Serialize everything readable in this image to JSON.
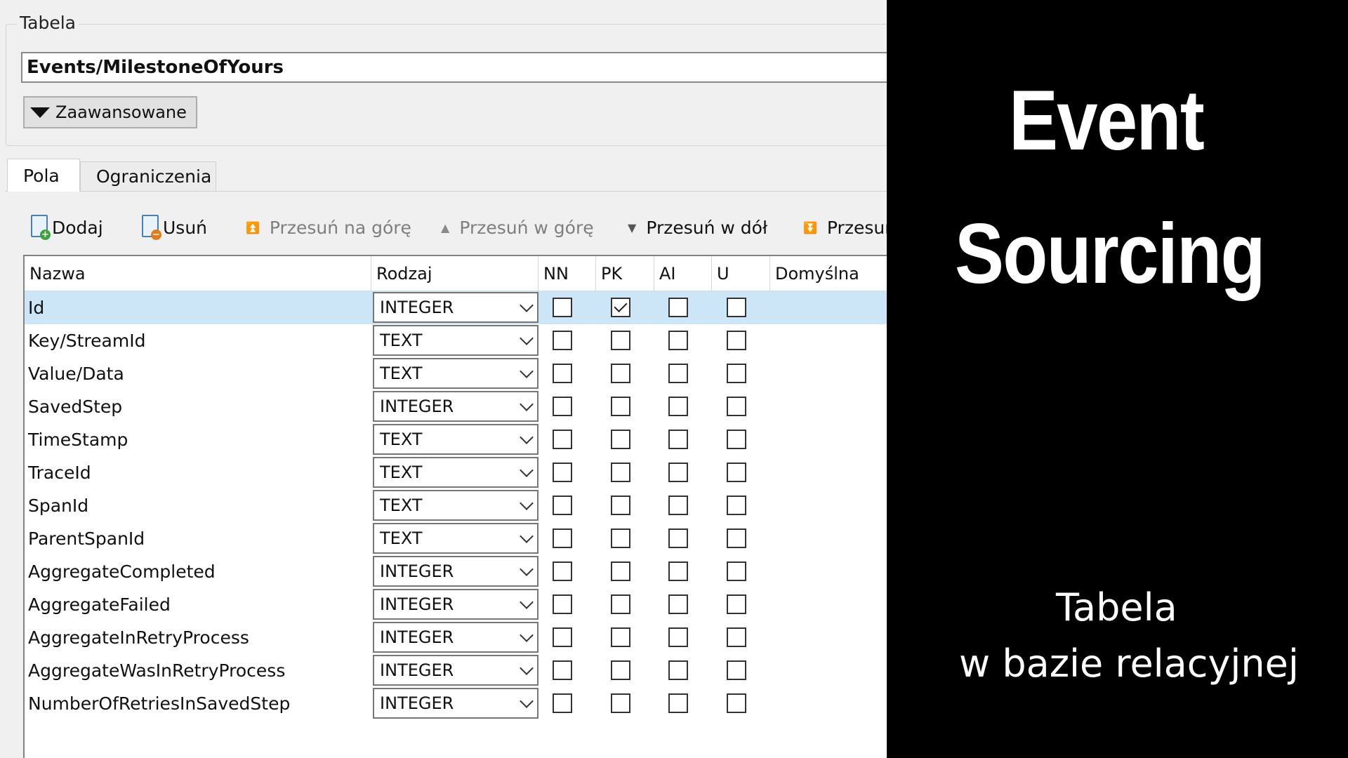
{
  "group": {
    "title": "Tabela",
    "table_name": "Events/MilestoneOfYours",
    "advanced_label": "Zaawansowane"
  },
  "tabs": [
    {
      "label": "Pola",
      "active": true
    },
    {
      "label": "Ograniczenia",
      "active": false
    }
  ],
  "toolbar": {
    "add": "Dodaj",
    "remove": "Usuń",
    "move_top": "Przesuń na górę",
    "move_up": "Przesuń w górę",
    "move_down": "Przesuń w dół",
    "move_bottom_partial": "Przesuń"
  },
  "columns": [
    "Nazwa",
    "Rodzaj",
    "NN",
    "PK",
    "AI",
    "U",
    "Domyślna"
  ],
  "fields": [
    {
      "name": "Id",
      "type": "INTEGER",
      "nn": false,
      "pk": true,
      "ai": false,
      "u": false,
      "selected": true
    },
    {
      "name": "Key/StreamId",
      "type": "TEXT",
      "nn": false,
      "pk": false,
      "ai": false,
      "u": false
    },
    {
      "name": "Value/Data",
      "type": "TEXT",
      "nn": false,
      "pk": false,
      "ai": false,
      "u": false
    },
    {
      "name": "SavedStep",
      "type": "INTEGER",
      "nn": false,
      "pk": false,
      "ai": false,
      "u": false
    },
    {
      "name": "TimeStamp",
      "type": "TEXT",
      "nn": false,
      "pk": false,
      "ai": false,
      "u": false
    },
    {
      "name": "TraceId",
      "type": "TEXT",
      "nn": false,
      "pk": false,
      "ai": false,
      "u": false
    },
    {
      "name": "SpanId",
      "type": "TEXT",
      "nn": false,
      "pk": false,
      "ai": false,
      "u": false
    },
    {
      "name": "ParentSpanId",
      "type": "TEXT",
      "nn": false,
      "pk": false,
      "ai": false,
      "u": false
    },
    {
      "name": "AggregateCompleted",
      "type": "INTEGER",
      "nn": false,
      "pk": false,
      "ai": false,
      "u": false
    },
    {
      "name": "AggregateFailed",
      "type": "INTEGER",
      "nn": false,
      "pk": false,
      "ai": false,
      "u": false
    },
    {
      "name": "AggregateInRetryProcess",
      "type": "INTEGER",
      "nn": false,
      "pk": false,
      "ai": false,
      "u": false
    },
    {
      "name": "AggregateWasInRetryProcess",
      "type": "INTEGER",
      "nn": false,
      "pk": false,
      "ai": false,
      "u": false
    },
    {
      "name": "NumberOfRetriesInSavedStep",
      "type": "INTEGER",
      "nn": false,
      "pk": false,
      "ai": false,
      "u": false
    }
  ],
  "overlay": {
    "title_line1": "Event",
    "title_line2": "Sourcing",
    "subtitle_line1": "Tabela",
    "subtitle_line2": "w bazie relacyjnej"
  },
  "colors": {
    "selection": "#cde6f7",
    "panel_bg": "#f0f0f0",
    "overlay_bg": "#000000"
  },
  "icons": {
    "add": "add-field-icon",
    "remove": "remove-field-icon",
    "advanced": "triangle-down-icon"
  }
}
